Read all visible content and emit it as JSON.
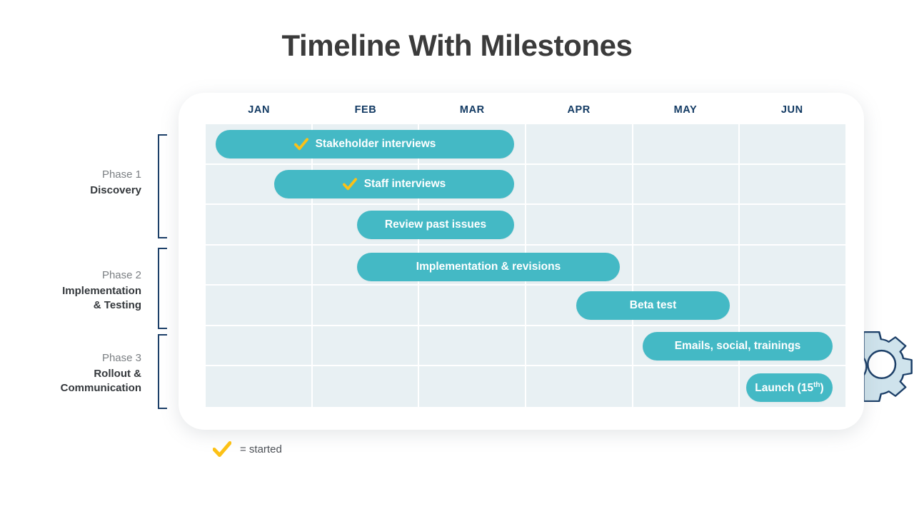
{
  "title": "Timeline With Milestones",
  "colors": {
    "bar_teal": "#44b9c5",
    "cell_bg": "#e8f0f3",
    "header_navy": "#123a63",
    "bracket_navy": "#1c3f68",
    "check_yellow": "#fcc116",
    "title_gray": "#3b3b3b",
    "gear_fill": "#cfe3ec",
    "gear_stroke": "#1c3f68"
  },
  "months": [
    "JAN",
    "FEB",
    "MAR",
    "APR",
    "MAY",
    "JUN"
  ],
  "phases": [
    {
      "kicker": "Phase 1",
      "name": "Discovery",
      "name_line2": ""
    },
    {
      "kicker": "Phase 2",
      "name": "Implementation",
      "name_line2": "& Testing"
    },
    {
      "kicker": "Phase 3",
      "name": "Rollout &",
      "name_line2": "Communication"
    }
  ],
  "tasks": [
    {
      "label": "Stakeholder interviews",
      "started": true,
      "ordinal": ""
    },
    {
      "label": "Staff interviews",
      "started": true,
      "ordinal": ""
    },
    {
      "label": "Review past issues",
      "started": false,
      "ordinal": ""
    },
    {
      "label": "Implementation & revisions",
      "started": false,
      "ordinal": ""
    },
    {
      "label": "Beta test",
      "started": false,
      "ordinal": ""
    },
    {
      "label": "Emails, social, trainings",
      "started": false,
      "ordinal": ""
    },
    {
      "label": "Launch (15",
      "started": false,
      "ordinal": "th",
      "label_tail": ")"
    }
  ],
  "legend": {
    "symbol": "check-icon",
    "text": "= started"
  },
  "chart_data": {
    "type": "bar",
    "title": "Timeline With Milestones",
    "xlabel": "",
    "ylabel": "",
    "categories": [
      "JAN",
      "FEB",
      "MAR",
      "APR",
      "MAY",
      "JUN"
    ],
    "grid": true,
    "legend_position": "bottom-left",
    "series": [
      {
        "name": "Stakeholder interviews",
        "phase": "Phase 1",
        "start_month": 1.0,
        "end_month": 3.9,
        "started": true
      },
      {
        "name": "Staff interviews",
        "phase": "Phase 1",
        "start_month": 1.65,
        "end_month": 3.9,
        "started": true
      },
      {
        "name": "Review past issues",
        "phase": "Phase 1",
        "start_month": 2.45,
        "end_month": 3.9,
        "started": false
      },
      {
        "name": "Implementation & revisions",
        "phase": "Phase 2",
        "start_month": 2.45,
        "end_month": 5.0,
        "started": false
      },
      {
        "name": "Beta test",
        "phase": "Phase 2",
        "start_month": 4.5,
        "end_month": 6.0,
        "started": false
      },
      {
        "name": "Emails, social, trainings",
        "phase": "Phase 3",
        "start_month": 5.1,
        "end_month": 6.9,
        "started": false
      },
      {
        "name": "Launch (15th)",
        "phase": "Phase 3",
        "start_month": 6.1,
        "end_month": 6.9,
        "started": false
      }
    ]
  }
}
